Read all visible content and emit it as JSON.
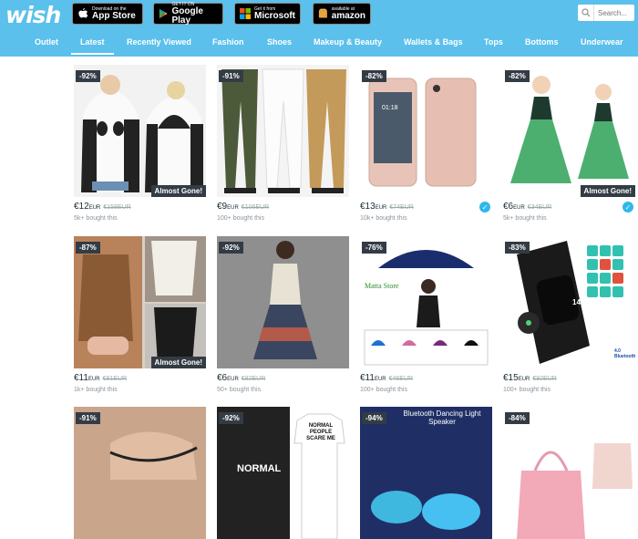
{
  "header": {
    "logo": "wish",
    "badges": [
      {
        "small": "Download on the",
        "big": "App Store"
      },
      {
        "small": "GET IT ON",
        "big": "Google Play"
      },
      {
        "small": "Get it from",
        "big": "Microsoft"
      },
      {
        "small": "available at",
        "big": "amazon"
      }
    ],
    "search_placeholder": "Search..."
  },
  "nav": [
    {
      "label": "Outlet"
    },
    {
      "label": "Latest"
    },
    {
      "label": "Recently Viewed"
    },
    {
      "label": "Fashion"
    },
    {
      "label": "Shoes"
    },
    {
      "label": "Makeup & Beauty"
    },
    {
      "label": "Wallets & Bags"
    },
    {
      "label": "Tops"
    },
    {
      "label": "Bottoms"
    },
    {
      "label": "Underwear"
    }
  ],
  "products": [
    {
      "discount": "-92%",
      "price": "€12",
      "currency": "EUR",
      "original": "€158EUR",
      "bought": "5k+ bought this",
      "tag": "Almost Gone!"
    },
    {
      "discount": "-91%",
      "price": "€9",
      "currency": "EUR",
      "original": "€106EUR",
      "bought": "100+ bought this",
      "tag": ""
    },
    {
      "discount": "-82%",
      "price": "€13",
      "currency": "EUR",
      "original": "€74EUR",
      "bought": "10k+ bought this",
      "tag": ""
    },
    {
      "discount": "-82%",
      "price": "€6",
      "currency": "EUR",
      "original": "€34EUR",
      "bought": "5k+ bought this",
      "tag": "Almost Gone!"
    },
    {
      "discount": "-87%",
      "price": "€11",
      "currency": "EUR",
      "original": "€91EUR",
      "bought": "1k+ bought this",
      "tag": "Almost Gone!"
    },
    {
      "discount": "-92%",
      "price": "€6",
      "currency": "EUR",
      "original": "€82EUR",
      "bought": "50+ bought this",
      "tag": ""
    },
    {
      "discount": "-76%",
      "price": "€11",
      "currency": "EUR",
      "original": "€46EUR",
      "bought": "100+ bought this",
      "tag": ""
    },
    {
      "discount": "-83%",
      "price": "€15",
      "currency": "EUR",
      "original": "€92EUR",
      "bought": "100+ bought this",
      "tag": ""
    },
    {
      "discount": "-91%"
    },
    {
      "discount": "-92%"
    },
    {
      "discount": "-94%"
    },
    {
      "discount": "-84%"
    }
  ],
  "image_text": {
    "phone_time": "01:18",
    "umbrella_store": "Matta Store",
    "watch_reading": "148",
    "watch_bluetooth": "4.0 Bluetooth",
    "shirt_text": "NORMAL PEOPLE SCARE ME",
    "tee_text": "NORMAL",
    "speaker_title": "Bluetooth Dancing Light Speaker"
  },
  "colors": {
    "accent": "#5bc0eb",
    "dark_badge": "#333c44",
    "check": "#2fb7ec"
  }
}
